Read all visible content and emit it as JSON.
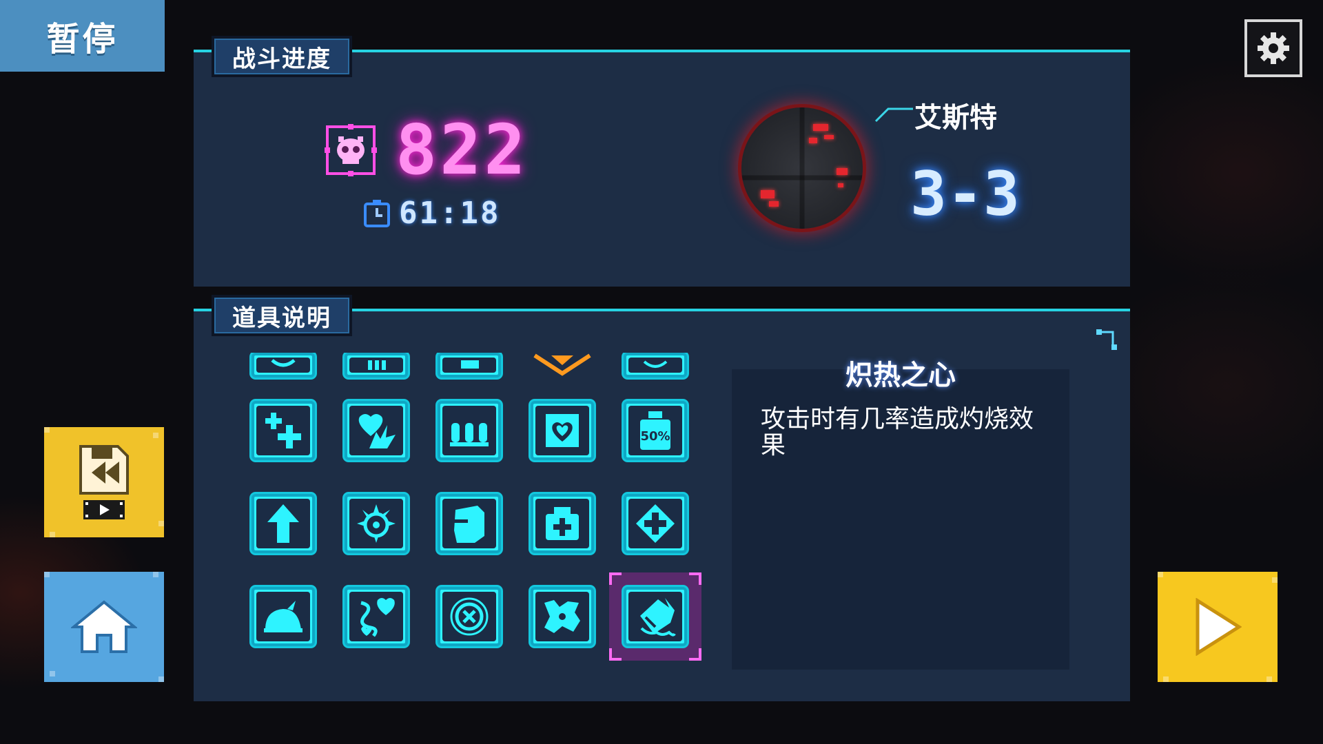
{
  "pause": {
    "label": "暂停"
  },
  "settings": {
    "icon": "gear-icon"
  },
  "battle": {
    "tab_label": "战斗进度",
    "kill_count": "822",
    "timer": "61:18",
    "area_name": "艾斯特",
    "stage": "3-3",
    "colors": {
      "kills": "#ff8ff0",
      "accent": "#27d2e2",
      "panel": "#1d2d45"
    }
  },
  "items": {
    "tab_label": "道具说明",
    "list": [
      {
        "icon": "ring-icon",
        "partial": true
      },
      {
        "icon": "bars-icon",
        "partial": true
      },
      {
        "icon": "book-icon",
        "partial": true
      },
      {
        "icon": "orange-chevron-icon",
        "partial": true
      },
      {
        "icon": "eye-icon",
        "partial": true
      },
      {
        "icon": "double-cross-icon"
      },
      {
        "icon": "heart-explosion-icon"
      },
      {
        "icon": "bullets-icon"
      },
      {
        "icon": "heart-card-icon"
      },
      {
        "icon": "bottle-50-icon"
      },
      {
        "icon": "arrow-up-icon"
      },
      {
        "icon": "spiky-target-icon"
      },
      {
        "icon": "fist-icon"
      },
      {
        "icon": "medkit-icon"
      },
      {
        "icon": "diamond-cross-icon"
      },
      {
        "icon": "helmet-icon"
      },
      {
        "icon": "serpent-heart-icon"
      },
      {
        "icon": "circle-x-icon"
      },
      {
        "icon": "splat-icon"
      },
      {
        "icon": "flaming-heart-icon",
        "selected": true
      }
    ],
    "selected": {
      "name": "炽热之心",
      "description": "攻击时有几率造成灼烧效果"
    }
  },
  "buttons": {
    "replay_icon": "save-rewind-icon",
    "home_icon": "home-icon",
    "continue_icon": "play-icon"
  }
}
